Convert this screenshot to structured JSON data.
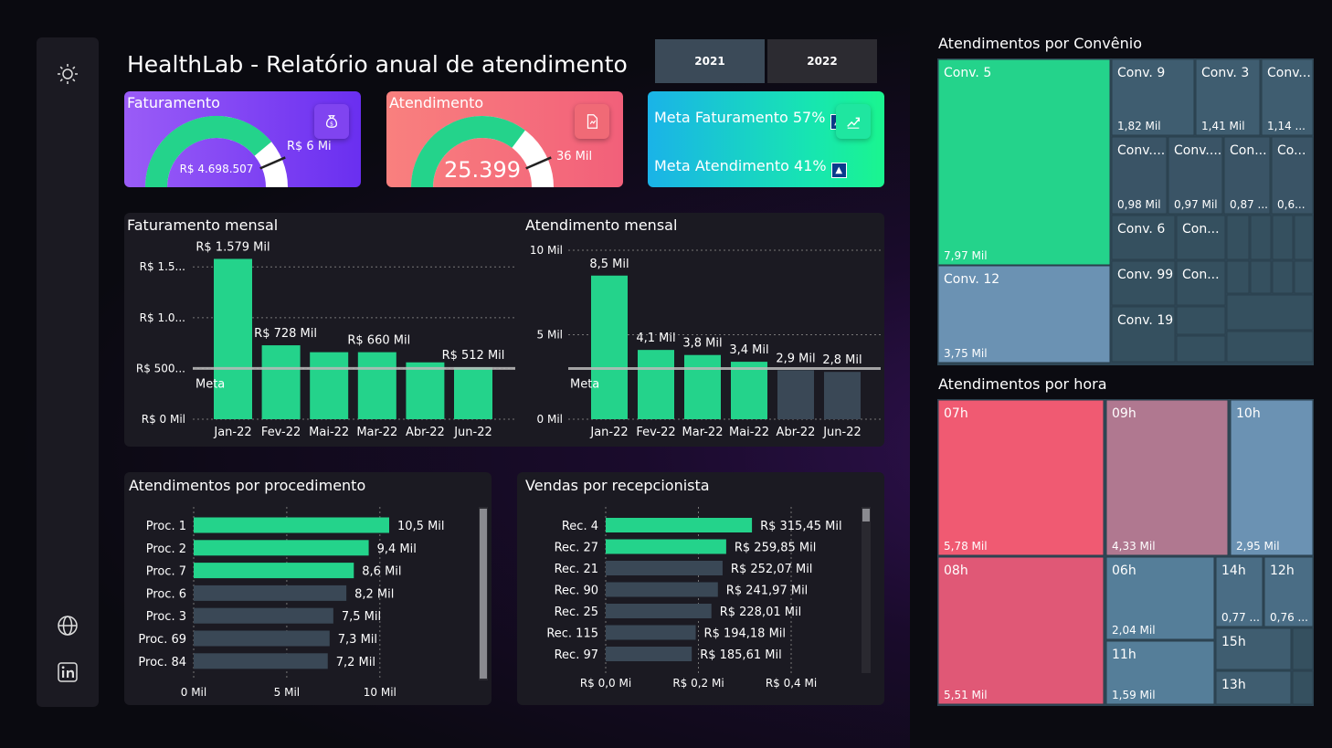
{
  "header": {
    "title": "HealthLab - Relatório anual de atendimento"
  },
  "years": [
    "2021",
    "2022"
  ],
  "sidebar": {
    "icons": [
      "sun-icon",
      "globe-icon",
      "linkedin-icon"
    ]
  },
  "kpis": {
    "faturamento": {
      "title": "Faturamento",
      "value": "R$ 4.698.507",
      "target": "R$ 6 Mi",
      "fraction": 0.78,
      "icon": "money-bag-icon"
    },
    "atendimento": {
      "title": "Atendimento",
      "value": "25.399",
      "target": "36 Mil",
      "fraction": 0.705,
      "icon": "report-icon"
    },
    "metas": {
      "lines": [
        "Meta Faturamento 57%",
        "Meta Atendimento 41%"
      ],
      "icon": "chart-up-icon"
    }
  },
  "colors": {
    "green": "#24d38b",
    "slate": "#3a4856",
    "coral": "#f05a72",
    "purple": "#7b3cf0"
  },
  "chart_data": [
    {
      "id": "faturamento_mensal",
      "type": "bar",
      "title": "Faturamento mensal",
      "categories": [
        "Jan-22",
        "Fev-22",
        "Mai-22",
        "Mar-22",
        "Abr-22",
        "Jun-22"
      ],
      "values": [
        1579,
        728,
        660,
        660,
        560,
        512
      ],
      "data_labels": [
        "R$ 1.579 Mil",
        "R$ 728 Mil",
        "",
        "R$ 660 Mil",
        "",
        "R$ 512 Mil"
      ],
      "yticks": [
        "R$ 0 Mil",
        "R$ 500...",
        "R$ 1.0...",
        "R$ 1.5..."
      ],
      "ytick_values": [
        0,
        500,
        1000,
        1500
      ],
      "ylim": [
        0,
        1700
      ],
      "meta_value": 500,
      "meta_label": "Meta"
    },
    {
      "id": "atendimento_mensal",
      "type": "bar",
      "title": "Atendimento mensal",
      "categories": [
        "Jan-22",
        "Fev-22",
        "Mar-22",
        "Mai-22",
        "Abr-22",
        "Jun-22"
      ],
      "values": [
        8.5,
        4.1,
        3.8,
        3.4,
        2.9,
        2.8
      ],
      "data_labels": [
        "8,5 Mil",
        "4,1 Mil",
        "3,8 Mil",
        "3,4 Mil",
        "2,9 Mil",
        "2,8 Mil"
      ],
      "below_meta": [
        false,
        false,
        false,
        false,
        true,
        true
      ],
      "yticks": [
        "0 Mil",
        "5 Mil",
        "10 Mil"
      ],
      "ytick_values": [
        0,
        5,
        10
      ],
      "ylim": [
        0,
        10
      ],
      "meta_value": 3,
      "meta_label": "Meta"
    },
    {
      "id": "atendimentos_por_procedimento",
      "type": "bar",
      "orientation": "horizontal",
      "title": "Atendimentos por procedimento",
      "categories": [
        "Proc. 1",
        "Proc. 2",
        "Proc. 7",
        "Proc. 6",
        "Proc. 3",
        "Proc. 69",
        "Proc. 84"
      ],
      "values": [
        10.5,
        9.4,
        8.6,
        8.2,
        7.5,
        7.3,
        7.2
      ],
      "data_labels": [
        "10,5 Mil",
        "9,4 Mil",
        "8,6 Mil",
        "8,2 Mil",
        "7,5 Mil",
        "7,3 Mil",
        "7,2 Mil"
      ],
      "highlight": [
        true,
        true,
        true,
        false,
        false,
        false,
        false
      ],
      "xticks": [
        "0 Mil",
        "5 Mil",
        "10 Mil"
      ],
      "xtick_values": [
        0,
        5,
        10
      ],
      "xlim": [
        0,
        10.5
      ]
    },
    {
      "id": "vendas_por_recepcionista",
      "type": "bar",
      "orientation": "horizontal",
      "title": "Vendas por recepcionista",
      "categories": [
        "Rec. 4",
        "Rec. 27",
        "Rec. 21",
        "Rec. 90",
        "Rec. 25",
        "Rec. 115",
        "Rec. 97"
      ],
      "values": [
        315.45,
        259.85,
        252.07,
        241.97,
        228.01,
        194.18,
        185.61
      ],
      "data_labels": [
        "R$ 315,45 Mil",
        "R$ 259,85 Mil",
        "R$ 252,07 Mil",
        "R$ 241,97 Mil",
        "R$ 228,01 Mil",
        "R$ 194,18 Mil",
        "R$ 185,61 Mil"
      ],
      "highlight": [
        true,
        true,
        false,
        false,
        false,
        false,
        false
      ],
      "xticks": [
        "R$ 0,0 Mi",
        "R$ 0,2 Mi",
        "R$ 0,4 Mi"
      ],
      "xtick_values": [
        0,
        200,
        400
      ],
      "xlim": [
        0,
        400
      ]
    },
    {
      "id": "atendimentos_por_convenio",
      "type": "heatmap",
      "subtype": "treemap",
      "title": "Atendimentos por Convênio",
      "items": [
        {
          "label": "Conv. 5",
          "value_label": "7,97 Mil",
          "value": 7.97
        },
        {
          "label": "Conv. 12",
          "value_label": "3,75 Mil",
          "value": 3.75
        },
        {
          "label": "Conv. 9",
          "value_label": "1,82 Mil",
          "value": 1.82
        },
        {
          "label": "Conv. 3",
          "value_label": "1,41 Mil",
          "value": 1.41
        },
        {
          "label": "Conv...",
          "value_label": "1,14 ...",
          "value": 1.14
        },
        {
          "label": "Conv....",
          "value_label": "0,98 Mil",
          "value": 0.98
        },
        {
          "label": "Conv....",
          "value_label": "0,97 Mil",
          "value": 0.97
        },
        {
          "label": "Con...",
          "value_label": "0,87 ...",
          "value": 0.87
        },
        {
          "label": "Co...",
          "value_label": "0,6...",
          "value": 0.6
        },
        {
          "label": "Conv. 6",
          "value_label": "",
          "value": null
        },
        {
          "label": "Con...",
          "value_label": "",
          "value": null
        },
        {
          "label": "Conv. 99",
          "value_label": "",
          "value": null
        },
        {
          "label": "Con...",
          "value_label": "",
          "value": null
        },
        {
          "label": "Conv. 19",
          "value_label": "",
          "value": null
        }
      ]
    },
    {
      "id": "atendimentos_por_hora",
      "type": "heatmap",
      "subtype": "treemap",
      "title": "Atendimentos por hora",
      "items": [
        {
          "label": "07h",
          "value_label": "5,78 Mil",
          "value": 5.78
        },
        {
          "label": "09h",
          "value_label": "4,33 Mil",
          "value": 4.33
        },
        {
          "label": "10h",
          "value_label": "2,95 Mil",
          "value": 2.95
        },
        {
          "label": "08h",
          "value_label": "5,51 Mil",
          "value": 5.51
        },
        {
          "label": "06h",
          "value_label": "2,04 Mil",
          "value": 2.04
        },
        {
          "label": "11h",
          "value_label": "1,59 Mil",
          "value": 1.59
        },
        {
          "label": "14h",
          "value_label": "0,77 ...",
          "value": 0.77
        },
        {
          "label": "12h",
          "value_label": "0,76 ...",
          "value": 0.76
        },
        {
          "label": "15h",
          "value_label": "",
          "value": null
        },
        {
          "label": "13h",
          "value_label": "",
          "value": null
        }
      ]
    }
  ]
}
